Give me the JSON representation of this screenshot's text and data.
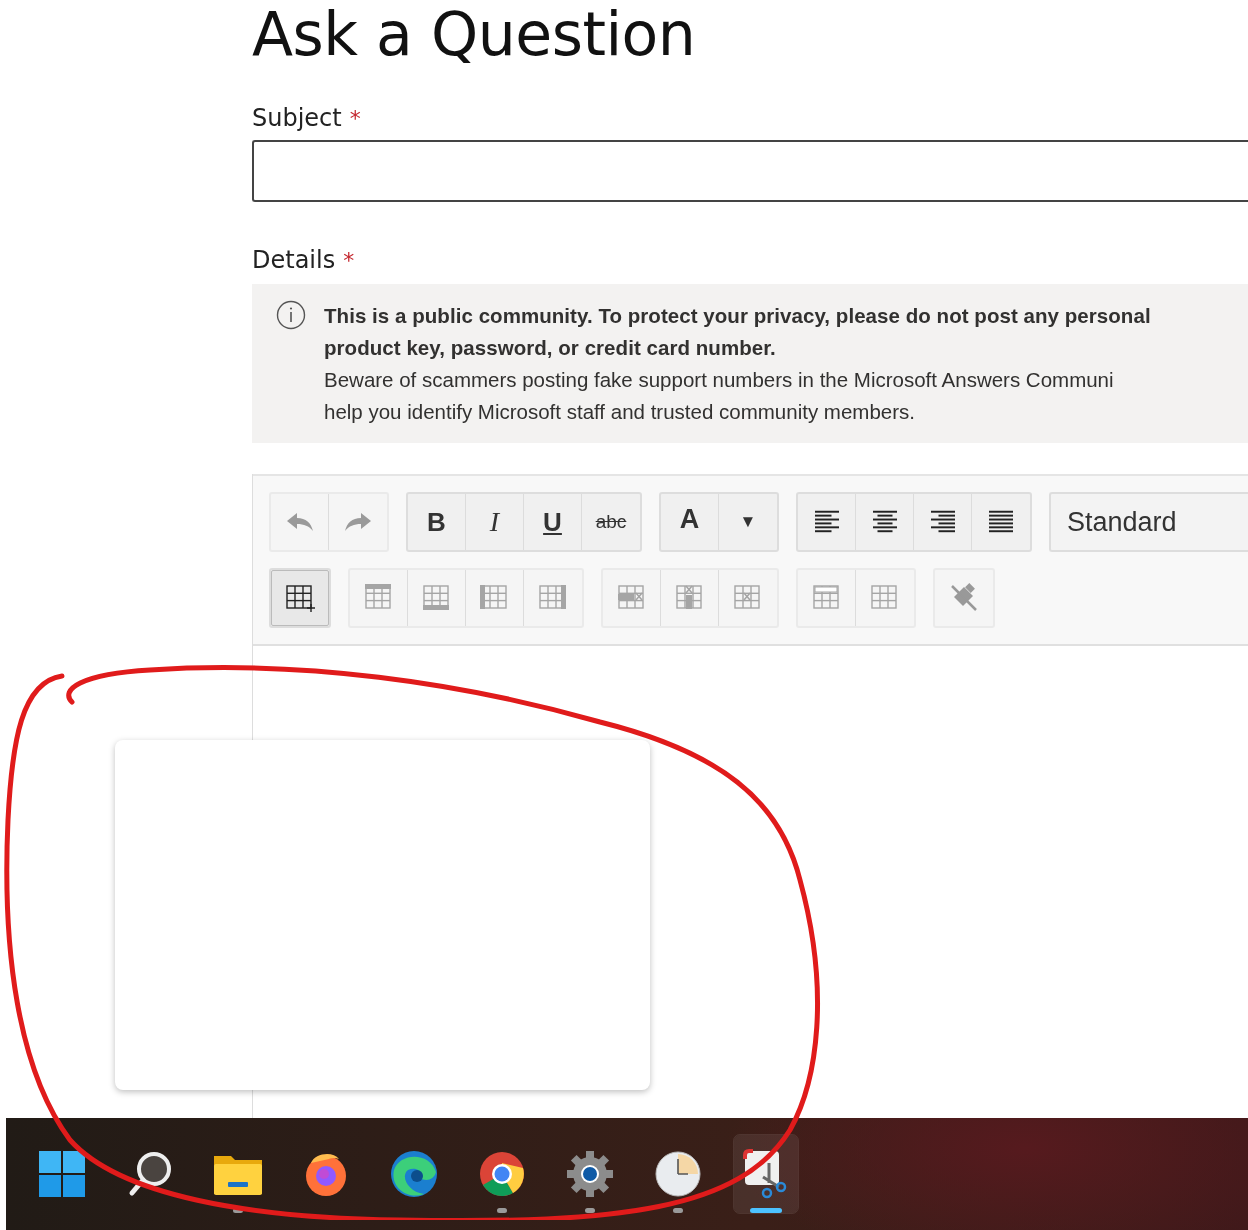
{
  "page_title": "Ask a Question",
  "subject": {
    "label": "Subject",
    "required_mark": "*"
  },
  "details": {
    "label": "Details",
    "required_mark": "*"
  },
  "notice": {
    "bold_lines": [
      "This is a public community. To protect your privacy, please do not post any personal",
      "product key, password, or credit card number."
    ],
    "lines": [
      "Beware of scammers posting fake support numbers in the Microsoft Answers Communi",
      "help you identify Microsoft staff and trusted community members."
    ]
  },
  "toolbar": {
    "rows": [
      [
        [
          {
            "kind": "undo",
            "disabled": true
          },
          {
            "kind": "redo",
            "disabled": true
          }
        ],
        [
          {
            "kind": "bold",
            "label": "B",
            "disabled": false
          },
          {
            "kind": "italic",
            "label": "I",
            "disabled": false
          },
          {
            "kind": "underline",
            "label": "U",
            "disabled": false
          },
          {
            "kind": "strike",
            "label": "abc",
            "disabled": false
          }
        ],
        [
          {
            "kind": "font-color",
            "label": "A",
            "disabled": false
          },
          {
            "kind": "dropdown",
            "label": "▼",
            "disabled": false
          }
        ],
        [
          {
            "kind": "align-left",
            "disabled": false
          },
          {
            "kind": "align-center",
            "disabled": false
          },
          {
            "kind": "align-right",
            "disabled": false
          },
          {
            "kind": "justify",
            "disabled": false
          }
        ]
      ],
      [
        [
          {
            "kind": "table-insert",
            "disabled": false
          }
        ],
        [
          {
            "kind": "row-above",
            "disabled": true
          },
          {
            "kind": "row-below",
            "disabled": true
          },
          {
            "kind": "col-left",
            "disabled": true
          },
          {
            "kind": "col-right",
            "disabled": true
          }
        ],
        [
          {
            "kind": "delete-row",
            "disabled": true
          },
          {
            "kind": "delete-col",
            "disabled": true
          },
          {
            "kind": "delete-table",
            "disabled": true
          }
        ],
        [
          {
            "kind": "header-row",
            "disabled": true
          },
          {
            "kind": "table-props",
            "disabled": true
          }
        ],
        [
          {
            "kind": "clear-format",
            "disabled": true
          }
        ]
      ]
    ],
    "style_select": "Standard"
  },
  "taskbar": [
    {
      "kind": "start",
      "running": false,
      "selected": false
    },
    {
      "kind": "search",
      "running": false,
      "selected": false
    },
    {
      "kind": "files",
      "running": true,
      "selected": false
    },
    {
      "kind": "firefox",
      "running": false,
      "selected": false
    },
    {
      "kind": "edge",
      "running": false,
      "selected": false
    },
    {
      "kind": "chrome",
      "running": true,
      "selected": false
    },
    {
      "kind": "settings",
      "running": true,
      "selected": false
    },
    {
      "kind": "clock",
      "running": true,
      "selected": false
    },
    {
      "kind": "snip",
      "running": true,
      "selected": true
    }
  ]
}
